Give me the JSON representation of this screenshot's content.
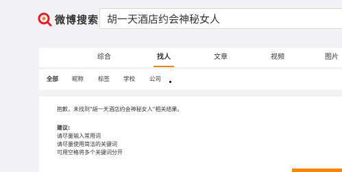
{
  "header": {
    "logo_text": "微博搜索",
    "search_value": "胡一天酒店约会神秘女人"
  },
  "type_tabs": [
    {
      "label": "综合",
      "active": false
    },
    {
      "label": "找人",
      "active": true
    },
    {
      "label": "文章",
      "active": false
    },
    {
      "label": "视频",
      "active": false
    },
    {
      "label": "图片",
      "active": false
    }
  ],
  "sub_tabs": [
    {
      "label": "全部",
      "active": true
    },
    {
      "label": "昵称",
      "active": false
    },
    {
      "label": "标签",
      "active": false
    },
    {
      "label": "学校",
      "active": false
    },
    {
      "label": "公司",
      "active": false
    }
  ],
  "result": {
    "message": "抱歉，未找到\"胡一天酒店约会神秘女人\"相关结果。",
    "tips_title": "建议:",
    "tips": [
      "请尽量输入常用词",
      "请尽量使用简洁的关键词",
      "可用空格将多个关键词分开"
    ]
  },
  "colors": {
    "accent": "#ff8200",
    "logo_red": "#e6162d",
    "page_bg": "#f2f2f5"
  }
}
